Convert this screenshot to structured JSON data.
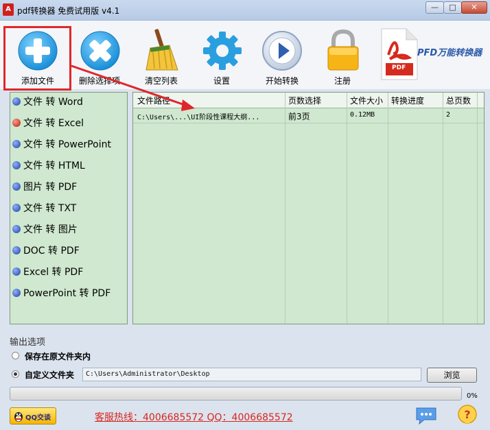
{
  "window": {
    "title": "pdf转换器 免费试用版 v4.1",
    "app_icon_glyph": "A",
    "controls": {
      "minimize": "—",
      "maximize": "□",
      "close": "✕"
    }
  },
  "toolbar": {
    "items": [
      {
        "label": "添加文件",
        "icon": "add-icon"
      },
      {
        "label": "删除选择项",
        "icon": "delete-icon"
      },
      {
        "label": "清空列表",
        "icon": "broom-icon"
      },
      {
        "label": "设置",
        "icon": "gear-icon"
      },
      {
        "label": "开始转换",
        "icon": "play-icon"
      },
      {
        "label": "注册",
        "icon": "lock-icon"
      }
    ],
    "brand_text": "PFD万能转换器",
    "brand_logo_text": "PDF"
  },
  "sidebar": {
    "items": [
      {
        "label": "文件 转 Word",
        "selected": false
      },
      {
        "label": "文件 转 Excel",
        "selected": true
      },
      {
        "label": "文件 转 PowerPoint",
        "selected": false
      },
      {
        "label": "文件 转 HTML",
        "selected": false
      },
      {
        "label": "图片 转 PDF",
        "selected": false
      },
      {
        "label": "文件 转 TXT",
        "selected": false
      },
      {
        "label": "文件 转 图片",
        "selected": false
      },
      {
        "label": "DOC 转 PDF",
        "selected": false
      },
      {
        "label": "Excel 转 PDF",
        "selected": false
      },
      {
        "label": "PowerPoint 转 PDF",
        "selected": false
      }
    ]
  },
  "file_table": {
    "columns": [
      "文件路径",
      "页数选择",
      "文件大小",
      "转换进度",
      "总页数"
    ],
    "rows": [
      {
        "path": "C:\\Users\\...\\UI阶段性课程大纲...",
        "pages": "前3页",
        "size": "0.12MB",
        "progress": "",
        "total": "2"
      }
    ]
  },
  "output": {
    "section_title": "输出选项",
    "option_original": "保存在原文件夹内",
    "option_custom": "自定义文件夹",
    "selected": "custom",
    "path": "C:\\Users\\Administrator\\Desktop",
    "browse_label": "浏览"
  },
  "progress": {
    "value": 0,
    "label": "0%"
  },
  "footer": {
    "qq_label": "QQ交谈",
    "hotline": "客服热线：4006685572 QQ：4006685572"
  },
  "colors": {
    "highlight": "#e0262a",
    "panel_green": "#cfe8cf",
    "hotline": "#d9251d"
  }
}
